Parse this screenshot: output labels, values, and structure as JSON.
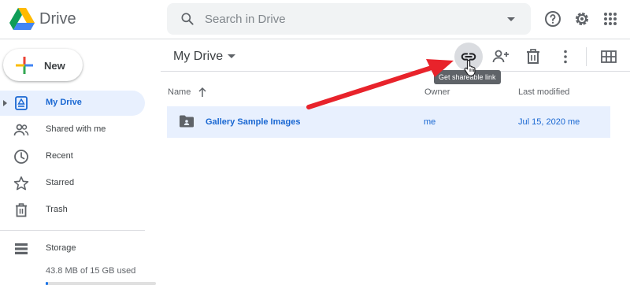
{
  "header": {
    "app_name": "Drive",
    "search_placeholder": "Search in Drive",
    "icons": [
      "google-drive-logo",
      "search-icon",
      "dropdown-caret-icon",
      "help-icon",
      "settings-icon",
      "apps-grid-icon"
    ]
  },
  "sidebar": {
    "new_label": "New",
    "items": [
      {
        "label": "My Drive",
        "icon": "my-drive-icon",
        "active": true
      },
      {
        "label": "Shared with me",
        "icon": "people-icon",
        "active": false
      },
      {
        "label": "Recent",
        "icon": "clock-icon",
        "active": false
      },
      {
        "label": "Starred",
        "icon": "star-icon",
        "active": false
      },
      {
        "label": "Trash",
        "icon": "trash-icon",
        "active": false
      }
    ],
    "storage": {
      "label": "Storage",
      "usage": "43.8 MB of 15 GB used",
      "used_fraction": 0.003
    }
  },
  "main": {
    "title": "My Drive",
    "tooltip": "Get shareable link",
    "columns": {
      "name": "Name",
      "owner": "Owner",
      "last_modified": "Last modified"
    },
    "rows": [
      {
        "name": "Gallery Sample Images",
        "owner": "me",
        "modified": "Jul 15, 2020 me",
        "type": "shared-folder"
      }
    ]
  },
  "colors": {
    "accent": "#1a73e8",
    "active_bg": "#e8f0fe",
    "active_text": "#1967d2",
    "annotation_arrow": "#e8232b"
  }
}
